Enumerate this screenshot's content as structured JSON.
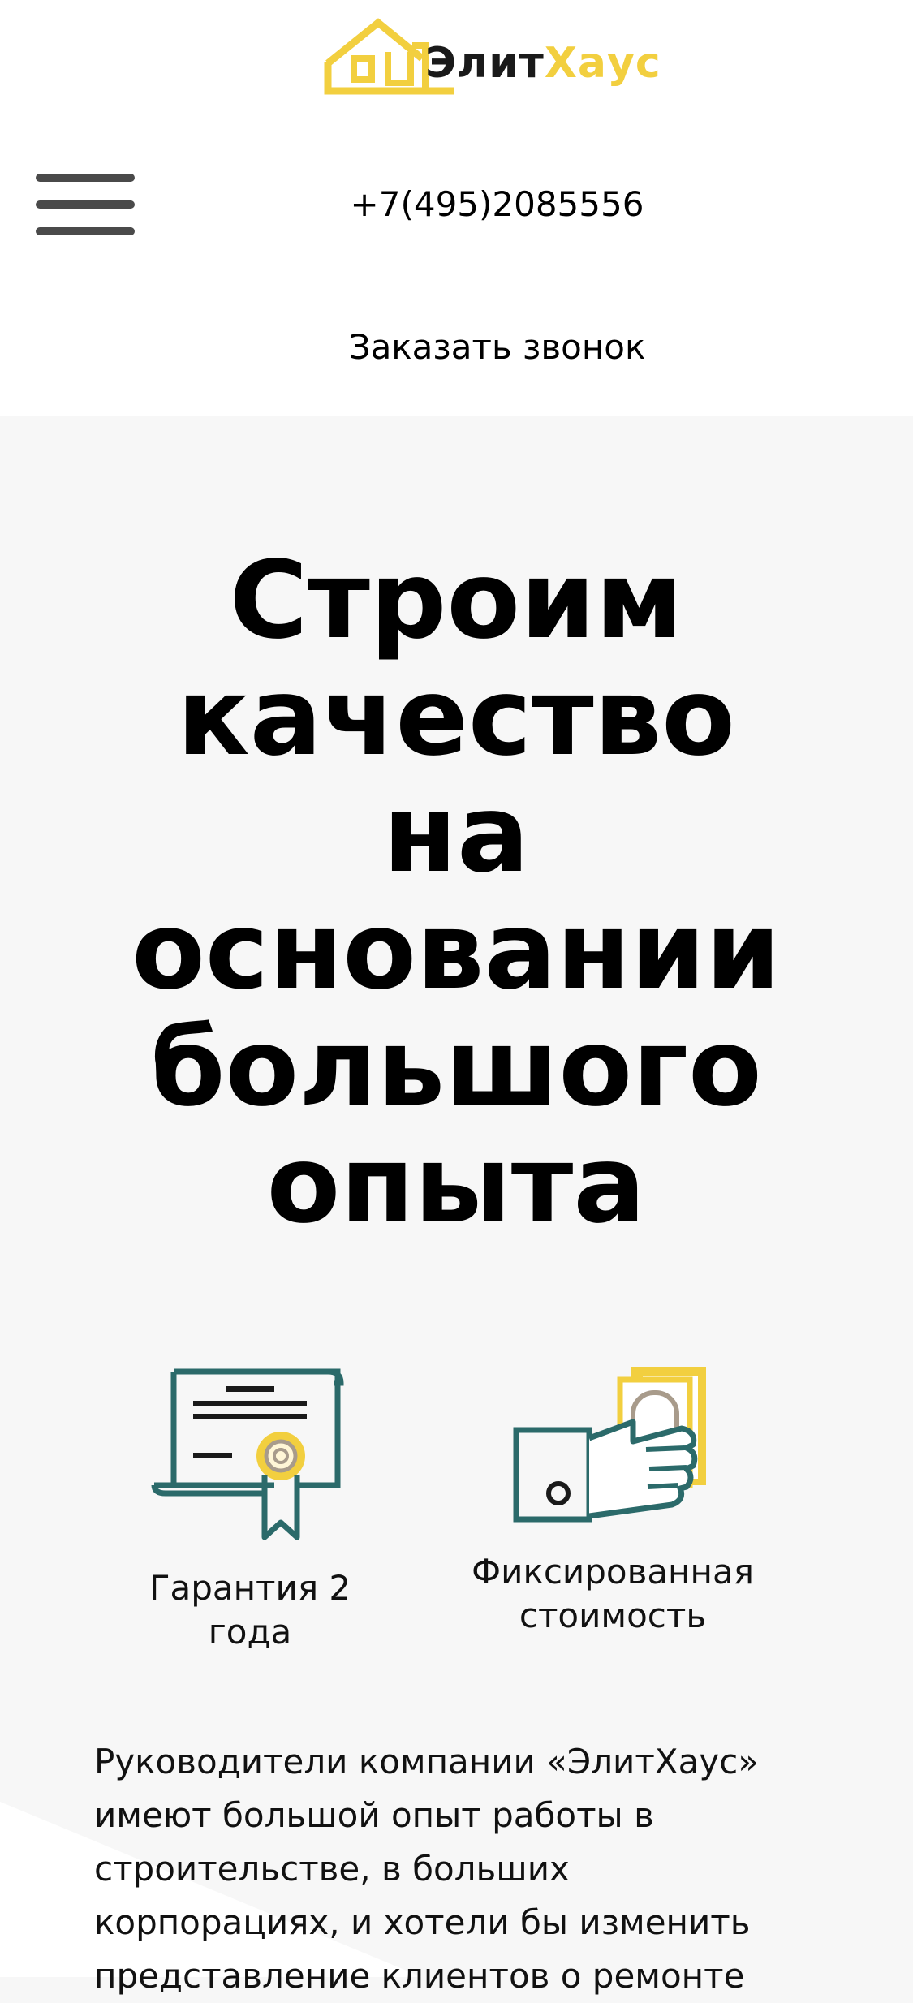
{
  "brand": {
    "name_part1": "Элит",
    "name_part2": "Хаус",
    "colors": {
      "accent": "#f2cf3f",
      "dark": "#1a1a1a",
      "icon_teal": "#2b6a6a"
    }
  },
  "header": {
    "menu_icon": "hamburger-icon",
    "phone": "+7(495)2085556",
    "callback_label": "Заказать звонок"
  },
  "hero": {
    "title": "Строим качество на основании большого опыта"
  },
  "features": [
    {
      "icon": "certificate-icon",
      "label": "Гарантия 2 года"
    },
    {
      "icon": "hand-money-icon",
      "label": "Фиксированная стоимость"
    }
  ],
  "about": {
    "text": "Руководители компании «ЭлитХаус» имеют большой опыт работы в строительстве, в больших корпорациях, и хотели бы изменить представление клиентов о ремонте"
  }
}
